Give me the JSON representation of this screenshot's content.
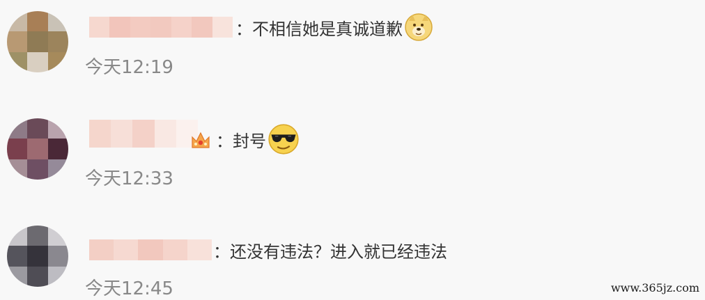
{
  "comments": [
    {
      "separator": "：",
      "text": "不相信她是真诚道歉",
      "time": "今天12:19",
      "emoji": "doge-icon"
    },
    {
      "separator": "：",
      "text": "封号",
      "time": "今天12:33",
      "emoji": "cool-sunglasses-icon"
    },
    {
      "separator": "：",
      "text": "还没有违法？进入就已经违法",
      "time": "今天12:45",
      "emoji": ""
    }
  ],
  "watermark": "www.365jz.com"
}
